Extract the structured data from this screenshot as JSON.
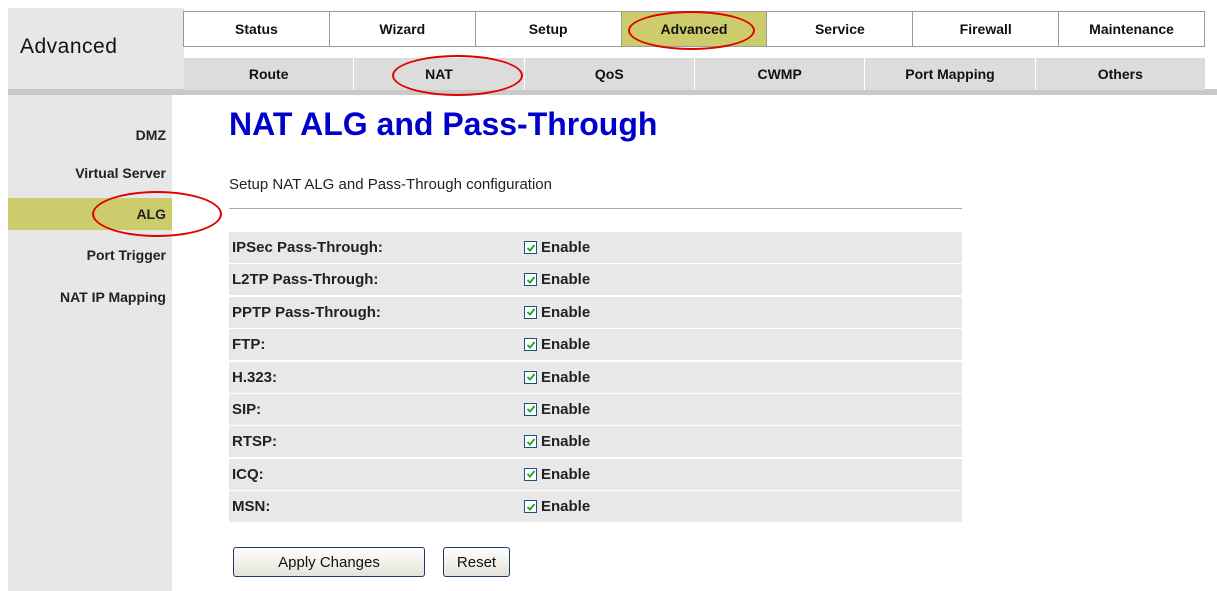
{
  "section_title": "Advanced",
  "tabs": [
    {
      "label": "Status",
      "active": false
    },
    {
      "label": "Wizard",
      "active": false
    },
    {
      "label": "Setup",
      "active": false
    },
    {
      "label": "Advanced",
      "active": true
    },
    {
      "label": "Service",
      "active": false
    },
    {
      "label": "Firewall",
      "active": false
    },
    {
      "label": "Maintenance",
      "active": false
    }
  ],
  "subtabs": [
    "Route",
    "NAT",
    "QoS",
    "CWMP",
    "Port Mapping",
    "Others"
  ],
  "sidebar": {
    "items": [
      {
        "label": "DMZ",
        "active": false
      },
      {
        "label": "Virtual Server",
        "active": false
      },
      {
        "label": "ALG",
        "active": true
      },
      {
        "label": "Port Trigger",
        "active": false
      },
      {
        "label": "NAT IP Mapping",
        "active": false
      }
    ]
  },
  "page": {
    "title": "NAT ALG and Pass-Through",
    "description": "Setup NAT ALG and Pass-Through configuration"
  },
  "options": [
    {
      "label": "IPSec Pass-Through:",
      "value": "Enable",
      "checked": true
    },
    {
      "label": "L2TP Pass-Through:",
      "value": "Enable",
      "checked": true
    },
    {
      "label": "PPTP Pass-Through:",
      "value": "Enable",
      "checked": true
    },
    {
      "label": "FTP:",
      "value": "Enable",
      "checked": true
    },
    {
      "label": "H.323:",
      "value": "Enable",
      "checked": true
    },
    {
      "label": "SIP:",
      "value": "Enable",
      "checked": true
    },
    {
      "label": "RTSP:",
      "value": "Enable",
      "checked": true
    },
    {
      "label": "ICQ:",
      "value": "Enable",
      "checked": true
    },
    {
      "label": "MSN:",
      "value": "Enable",
      "checked": true
    }
  ],
  "buttons": {
    "apply": "Apply Changes",
    "reset": "Reset"
  },
  "colors": {
    "active_tab": "#cccc6c",
    "title_blue": "#0000cc",
    "annotation_red": "#e00000",
    "row_bg": "#e8e8e8"
  },
  "icons": {
    "checkbox": "checkbox-checked-icon"
  }
}
